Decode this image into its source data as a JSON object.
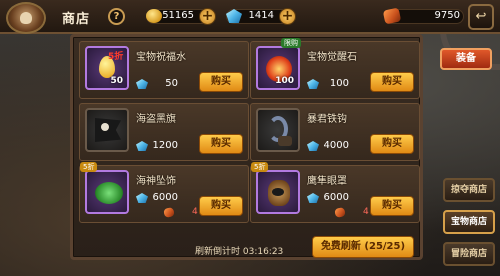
{
  "header": {
    "title": "商店",
    "help": "?",
    "gold": "51165",
    "gems": "1414",
    "ore": "9750",
    "exit": "↩"
  },
  "equip_label": "装备",
  "items": [
    {
      "name": "宝物祝福水",
      "qty": "50",
      "price": "50",
      "buy": "购买",
      "promo": "5折",
      "img_label": "💧"
    },
    {
      "name": "宝物觉醒石",
      "qty": "100",
      "price": "100",
      "buy": "购买",
      "badge": "限购",
      "img_label": "🔥"
    },
    {
      "name": "海盗黑旗",
      "qty": "",
      "price": "1200",
      "buy": "购买",
      "img_label": "☠"
    },
    {
      "name": "暴君铁钩",
      "qty": "",
      "price": "4000",
      "buy": "购买",
      "img_label": "🪝"
    },
    {
      "name": "海神坠饰",
      "qty": "",
      "price": "6000",
      "sub_price": "4",
      "buy": "购买",
      "badge": "5折",
      "img_label": "🐢"
    },
    {
      "name": "鹰隼眼罩",
      "qty": "",
      "price": "6000",
      "sub_price": "4",
      "buy": "购买",
      "badge": "5折",
      "img_label": "🦅"
    }
  ],
  "footer": {
    "refresh_countdown": "刷新倒计时 03:16:23",
    "refresh_button": "免费刷新 (25/25)"
  },
  "side_nav": [
    {
      "label": "掠夺商店"
    },
    {
      "label": "宝物商店"
    },
    {
      "label": "冒险商店"
    }
  ]
}
